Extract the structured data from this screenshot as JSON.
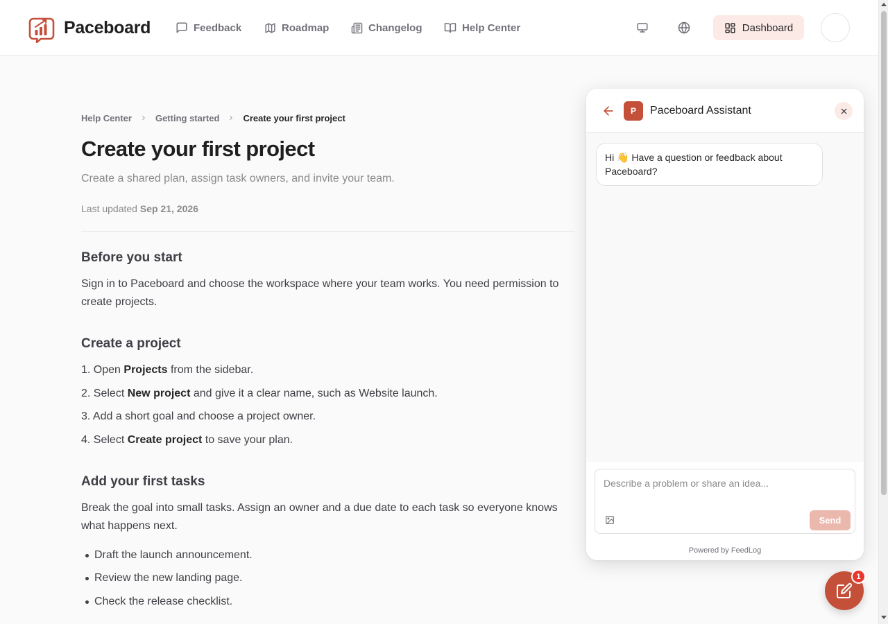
{
  "header": {
    "brand": "Paceboard",
    "nav": [
      {
        "label": "Feedback",
        "icon": "message-square-icon"
      },
      {
        "label": "Roadmap",
        "icon": "map-icon"
      },
      {
        "label": "Changelog",
        "icon": "newspaper-icon"
      },
      {
        "label": "Help Center",
        "icon": "book-open-icon"
      }
    ],
    "dashboard_label": "Dashboard"
  },
  "article": {
    "breadcrumb": [
      "Help Center",
      "Getting started",
      "Create your first project"
    ],
    "title": "Create your first project",
    "subtitle": "Create a shared plan, assign task owners, and invite your team.",
    "updated_prefix": "Last updated",
    "updated_date": "Sep 21, 2026",
    "sections": [
      {
        "heading": "Before you start",
        "body": "Sign in to Paceboard and choose the workspace where your team works. You need permission to create projects."
      },
      {
        "heading": "Create a project",
        "steps": [
          {
            "num": "1.",
            "pre": "Open ",
            "bold": "Projects",
            "post": " from the sidebar."
          },
          {
            "num": "2.",
            "pre": "Select ",
            "bold": "New project",
            "post": " and give it a clear name, such as Website launch."
          },
          {
            "num": "3.",
            "pre": "Add a short goal and choose a project owner.",
            "bold": "",
            "post": ""
          },
          {
            "num": "4.",
            "pre": "Select ",
            "bold": "Create project",
            "post": " to save your plan."
          }
        ]
      },
      {
        "heading": "Add your first tasks",
        "body": "Break the goal into small tasks. Assign an owner and a due date to each task so everyone knows what happens next.",
        "bullets": [
          "Draft the launch announcement.",
          "Review the new landing page.",
          "Check the release checklist."
        ]
      }
    ]
  },
  "chat": {
    "avatar_letter": "P",
    "title": "Paceboard Assistant",
    "greeting": "Hi 👋 Have a question or feedback about Paceboard?",
    "placeholder": "Describe a problem or share an idea...",
    "send_label": "Send",
    "powered_by": "Powered by FeedLog"
  },
  "fab": {
    "badge_count": "1"
  },
  "colors": {
    "accent": "#c4503a",
    "accent_soft": "#fbeae6",
    "badge": "#e5392f",
    "send_disabled": "#ebb8ad"
  }
}
